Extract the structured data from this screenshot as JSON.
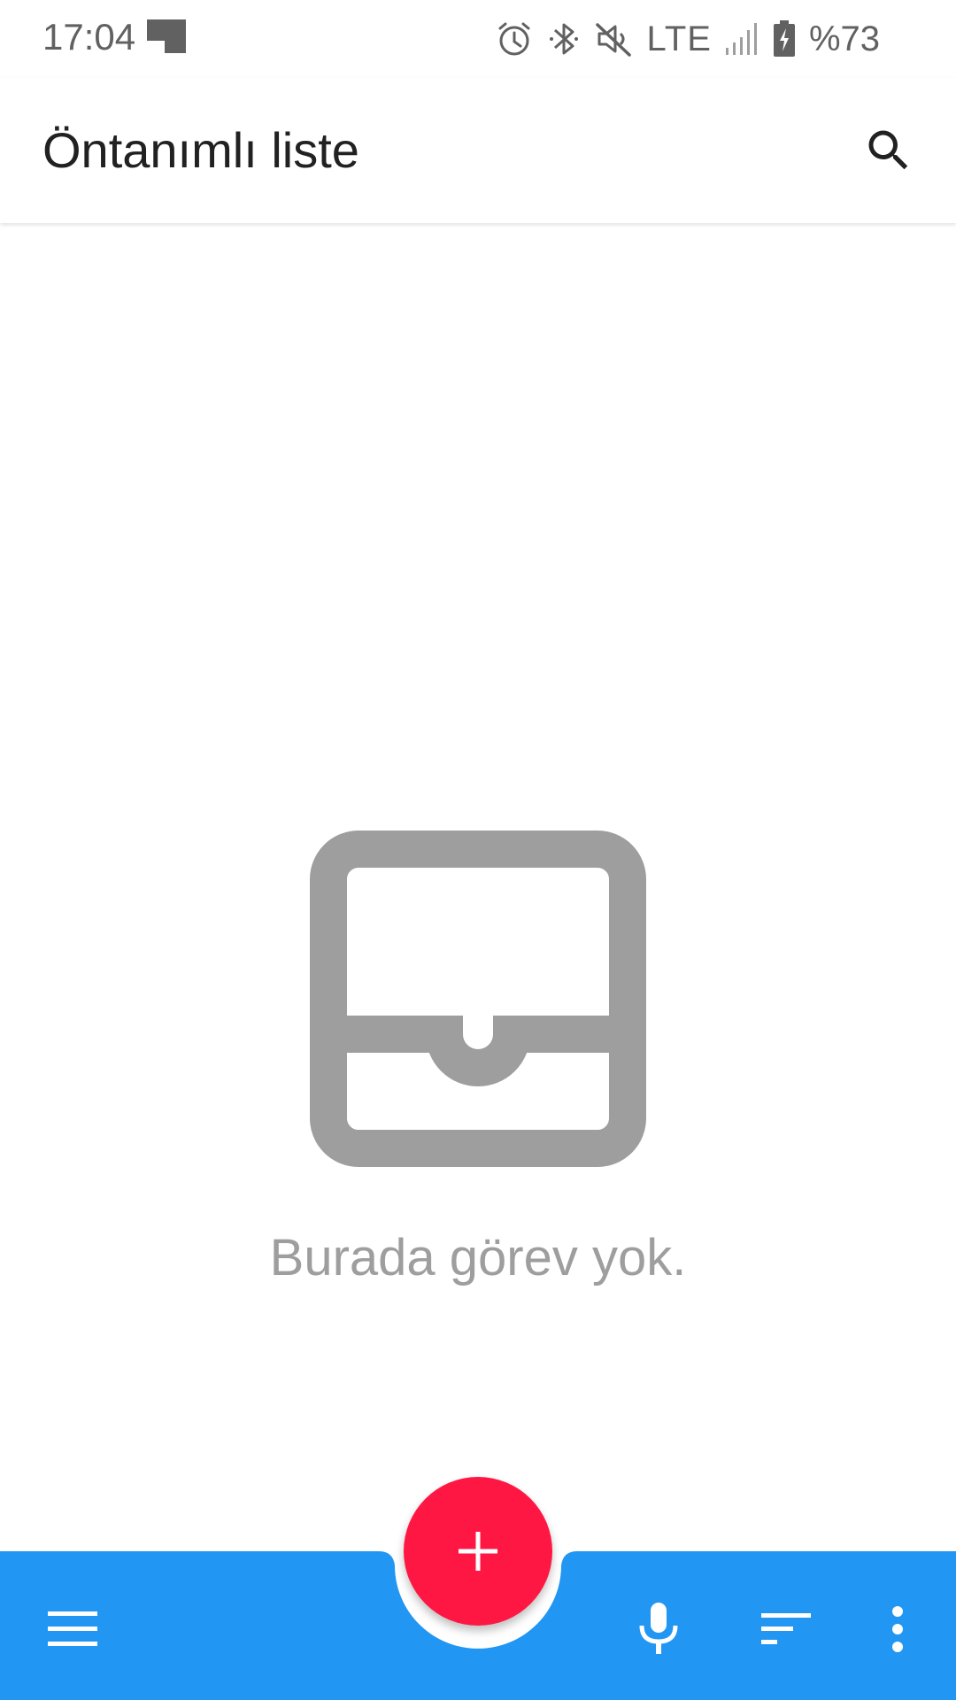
{
  "status_bar": {
    "time": "17:04",
    "network": "LTE",
    "battery": "%73",
    "icons": [
      "notification-icon",
      "alarm-icon",
      "bluetooth-icon",
      "mute-icon",
      "signal-icon",
      "battery-charging-icon"
    ]
  },
  "app_bar": {
    "title": "Öntanımlı liste",
    "search_icon": "search-icon"
  },
  "empty_state": {
    "icon": "inbox-icon",
    "message": "Burada görev yok."
  },
  "bottom_bar": {
    "icons": [
      "menu-icon",
      "microphone-icon",
      "sort-icon",
      "more-vert-icon"
    ],
    "fab_icon": "add-icon"
  },
  "colors": {
    "accent_blue": "#2196f3",
    "fab_red": "#ff1744",
    "empty_gray": "#9e9e9e",
    "title_text": "#212121"
  }
}
